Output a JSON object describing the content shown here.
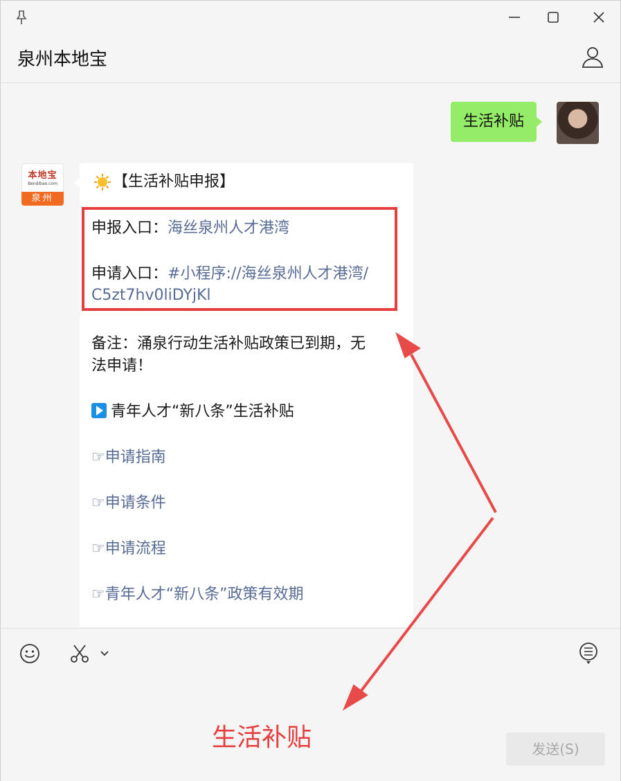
{
  "window": {
    "title": "泉州本地宝"
  },
  "messages": {
    "me": {
      "text": "生活补贴"
    },
    "bot": {
      "avatar": {
        "logo_text": "本地宝",
        "logo_subtext": "Bendibao.com",
        "city": "泉州"
      },
      "header": "【生活补贴申报】",
      "entry1_label": "申报入口：",
      "entry1_link": "海丝泉州人才港湾",
      "entry2_label": "申请入口：",
      "entry2_link_line1": "#小程序://海丝泉州人才港湾/",
      "entry2_link_line2": "C5zt7hv0liDYjKl",
      "note_line1": "备注：涌泉行动生活补贴政策已到期，无",
      "note_line2": "法申请！",
      "section_title": "青年人才“新八条”生活补贴",
      "links": [
        "☞申请指南",
        "☞申请条件",
        "☞申请流程",
        "☞青年人才“新八条”政策有效期"
      ]
    }
  },
  "toolbar": {
    "send_label": "发送(S)"
  },
  "annotation": {
    "text": "生活补贴",
    "color": "#e63e3e"
  },
  "colors": {
    "my_bubble": "#95ec69",
    "link": "#576b95",
    "highlight_box": "#e63e3e"
  },
  "icons": {
    "pin": "pin-icon",
    "minimize": "minimize-icon",
    "maximize": "maximize-icon",
    "close": "close-icon",
    "profile": "profile-icon",
    "emoji": "emoji-icon",
    "scissors": "scissors-icon",
    "history": "chat-history-icon"
  }
}
